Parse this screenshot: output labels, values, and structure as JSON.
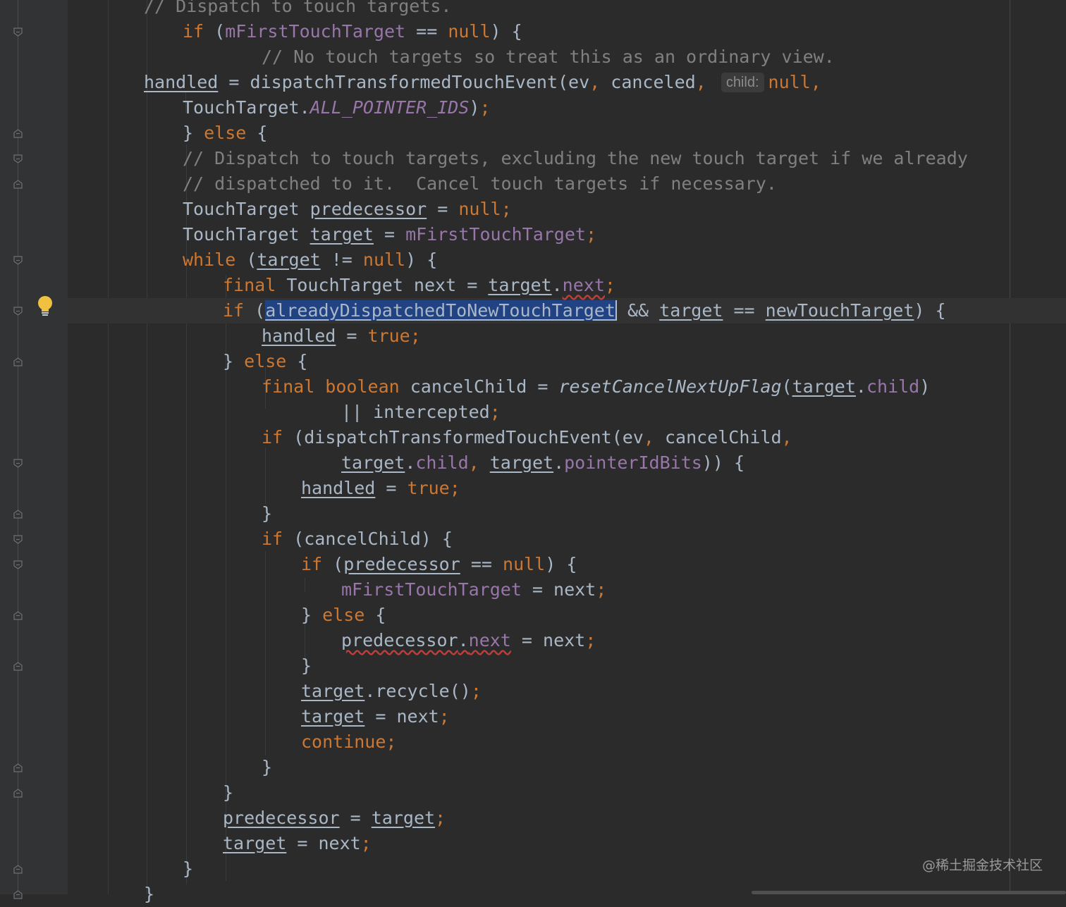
{
  "editor": {
    "lines": [
      [
        {
          "t": "// Dispatch to touch targets.",
          "c": "cmt"
        }
      ],
      [
        {
          "t": "if",
          "c": "kw"
        },
        {
          "t": " ("
        },
        {
          "t": "mFirstTouchTarget",
          "c": "fld"
        },
        {
          "t": " == "
        },
        {
          "t": "null",
          "c": "kw"
        },
        {
          "t": ") {"
        }
      ],
      [
        {
          "t": "// No touch targets so treat this as an ordinary view.",
          "c": "cmt"
        }
      ],
      [
        {
          "t": "handled",
          "c": "ul"
        },
        {
          "t": " = dispatchTransformedTouchEvent(ev"
        },
        {
          "t": ",",
          "c": "kw"
        },
        {
          "t": " canceled"
        },
        {
          "t": ",",
          "c": "kw"
        },
        {
          "t": " "
        },
        {
          "t": "child:",
          "c": "hint"
        },
        {
          "t": "null,",
          "c": "kw"
        }
      ],
      [
        {
          "t": "TouchTarget."
        },
        {
          "t": "ALL_POINTER_IDS",
          "c": "sfld"
        },
        {
          "t": ")"
        },
        {
          "t": ";",
          "c": "kw"
        }
      ],
      [
        {
          "t": "} "
        },
        {
          "t": "else",
          "c": "kw"
        },
        {
          "t": " {"
        }
      ],
      [
        {
          "t": "// Dispatch to touch targets, excluding the new touch target if we already",
          "c": "cmt"
        }
      ],
      [
        {
          "t": "// dispatched to it.  Cancel touch targets if necessary.",
          "c": "cmt"
        }
      ],
      [
        {
          "t": "TouchTarget "
        },
        {
          "t": "predecessor",
          "c": "ul"
        },
        {
          "t": " = "
        },
        {
          "t": "null;",
          "c": "kw"
        }
      ],
      [
        {
          "t": "TouchTarget "
        },
        {
          "t": "target",
          "c": "ul"
        },
        {
          "t": " = "
        },
        {
          "t": "mFirstTouchTarget",
          "c": "fld"
        },
        {
          "t": ";",
          "c": "kw"
        }
      ],
      [
        {
          "t": "while",
          "c": "kw"
        },
        {
          "t": " ("
        },
        {
          "t": "target",
          "c": "ul"
        },
        {
          "t": " != "
        },
        {
          "t": "null",
          "c": "kw"
        },
        {
          "t": ") {"
        }
      ],
      [
        {
          "t": "final",
          "c": "kw"
        },
        {
          "t": " TouchTarget next = "
        },
        {
          "t": "target",
          "c": "ul"
        },
        {
          "t": "."
        },
        {
          "t": "next",
          "c": "fld warn"
        },
        {
          "t": ";",
          "c": "kw"
        }
      ],
      [
        {
          "t": "if",
          "c": "kw"
        },
        {
          "t": " ("
        },
        {
          "t": "alreadyDispatchedToNewTouchTarget",
          "c": "sel"
        },
        {
          "t": " && "
        },
        {
          "t": "target",
          "c": "ul"
        },
        {
          "t": " == "
        },
        {
          "t": "newTouchTarget",
          "c": "ul"
        },
        {
          "t": ") {"
        }
      ],
      [
        {
          "t": "handled",
          "c": "ul"
        },
        {
          "t": " = "
        },
        {
          "t": "true;",
          "c": "kw"
        }
      ],
      [
        {
          "t": "} "
        },
        {
          "t": "else",
          "c": "kw"
        },
        {
          "t": " {"
        }
      ],
      [
        {
          "t": "final boolean",
          "c": "kw"
        },
        {
          "t": " cancelChild = "
        },
        {
          "t": "resetCancelNextUpFlag",
          "c": "ital"
        },
        {
          "t": "("
        },
        {
          "t": "target",
          "c": "ul"
        },
        {
          "t": "."
        },
        {
          "t": "child",
          "c": "fld"
        },
        {
          "t": ")"
        }
      ],
      [
        {
          "t": "|| intercepted"
        },
        {
          "t": ";",
          "c": "kw"
        }
      ],
      [
        {
          "t": "if",
          "c": "kw"
        },
        {
          "t": " (dispatchTransformedTouchEvent(ev"
        },
        {
          "t": ",",
          "c": "kw"
        },
        {
          "t": " cancelChild"
        },
        {
          "t": ",",
          "c": "kw"
        }
      ],
      [
        {
          "t": "target",
          "c": "ul"
        },
        {
          "t": "."
        },
        {
          "t": "child",
          "c": "fld"
        },
        {
          "t": ", ",
          "c": "kw"
        },
        {
          "t": "target",
          "c": "ul"
        },
        {
          "t": "."
        },
        {
          "t": "pointerIdBits",
          "c": "fld"
        },
        {
          "t": ")) {"
        }
      ],
      [
        {
          "t": "handled",
          "c": "ul"
        },
        {
          "t": " = "
        },
        {
          "t": "true;",
          "c": "kw"
        }
      ],
      [
        {
          "t": "}"
        }
      ],
      [
        {
          "t": "if",
          "c": "kw"
        },
        {
          "t": " (cancelChild) {"
        }
      ],
      [
        {
          "t": "if",
          "c": "kw"
        },
        {
          "t": " ("
        },
        {
          "t": "predecessor",
          "c": "ul"
        },
        {
          "t": " == "
        },
        {
          "t": "null",
          "c": "kw"
        },
        {
          "t": ") {"
        }
      ],
      [
        {
          "t": "mFirstTouchTarget",
          "c": "fld"
        },
        {
          "t": " = next"
        },
        {
          "t": ";",
          "c": "kw"
        }
      ],
      [
        {
          "t": "} "
        },
        {
          "t": "else",
          "c": "kw"
        },
        {
          "t": " {"
        }
      ],
      [
        {
          "t": "predecessor",
          "c": "ul warn"
        },
        {
          "t": ".",
          "c": "warn"
        },
        {
          "t": "next",
          "c": "fld warn"
        },
        {
          "t": " = next"
        },
        {
          "t": ";",
          "c": "kw"
        }
      ],
      [
        {
          "t": "}"
        }
      ],
      [
        {
          "t": "target",
          "c": "ul"
        },
        {
          "t": ".recycle()"
        },
        {
          "t": ";",
          "c": "kw"
        }
      ],
      [
        {
          "t": "target",
          "c": "ul"
        },
        {
          "t": " = next"
        },
        {
          "t": ";",
          "c": "kw"
        }
      ],
      [
        {
          "t": "continue;",
          "c": "kw"
        }
      ],
      [
        {
          "t": "}"
        }
      ],
      [
        {
          "t": "}"
        }
      ],
      [
        {
          "t": "predecessor",
          "c": "ul"
        },
        {
          "t": " = "
        },
        {
          "t": "target",
          "c": "ul"
        },
        {
          "t": ";",
          "c": "kw"
        }
      ],
      [
        {
          "t": "target",
          "c": "ul"
        },
        {
          "t": " = next"
        },
        {
          "t": ";",
          "c": "kw"
        }
      ],
      [
        {
          "t": "}"
        }
      ],
      [
        {
          "t": "}"
        }
      ]
    ]
  },
  "gutter": {
    "fold_markers": [
      {
        "line": 1,
        "kind": "open"
      },
      {
        "line": 5,
        "kind": "close"
      },
      {
        "line": 6,
        "kind": "open"
      },
      {
        "line": 7,
        "kind": "close"
      },
      {
        "line": 10,
        "kind": "open"
      },
      {
        "line": 12,
        "kind": "open"
      },
      {
        "line": 14,
        "kind": "close"
      },
      {
        "line": 18,
        "kind": "open"
      },
      {
        "line": 20,
        "kind": "close"
      },
      {
        "line": 21,
        "kind": "open"
      },
      {
        "line": 22,
        "kind": "open"
      },
      {
        "line": 24,
        "kind": "close"
      },
      {
        "line": 26,
        "kind": "close"
      },
      {
        "line": 30,
        "kind": "close"
      },
      {
        "line": 31,
        "kind": "close"
      },
      {
        "line": 34,
        "kind": "close"
      },
      {
        "line": 35,
        "kind": "close"
      }
    ],
    "intention_icon": "lightbulb-icon"
  },
  "watermark": "@稀土掘金技术社区",
  "colors": {
    "background": "#2b2b2b",
    "gutter": "#313335",
    "keyword": "#cc7832",
    "field": "#9876aa",
    "comment": "#808080",
    "text": "#a9b7c6",
    "selection": "#214283",
    "bulb": "#f0c040"
  }
}
